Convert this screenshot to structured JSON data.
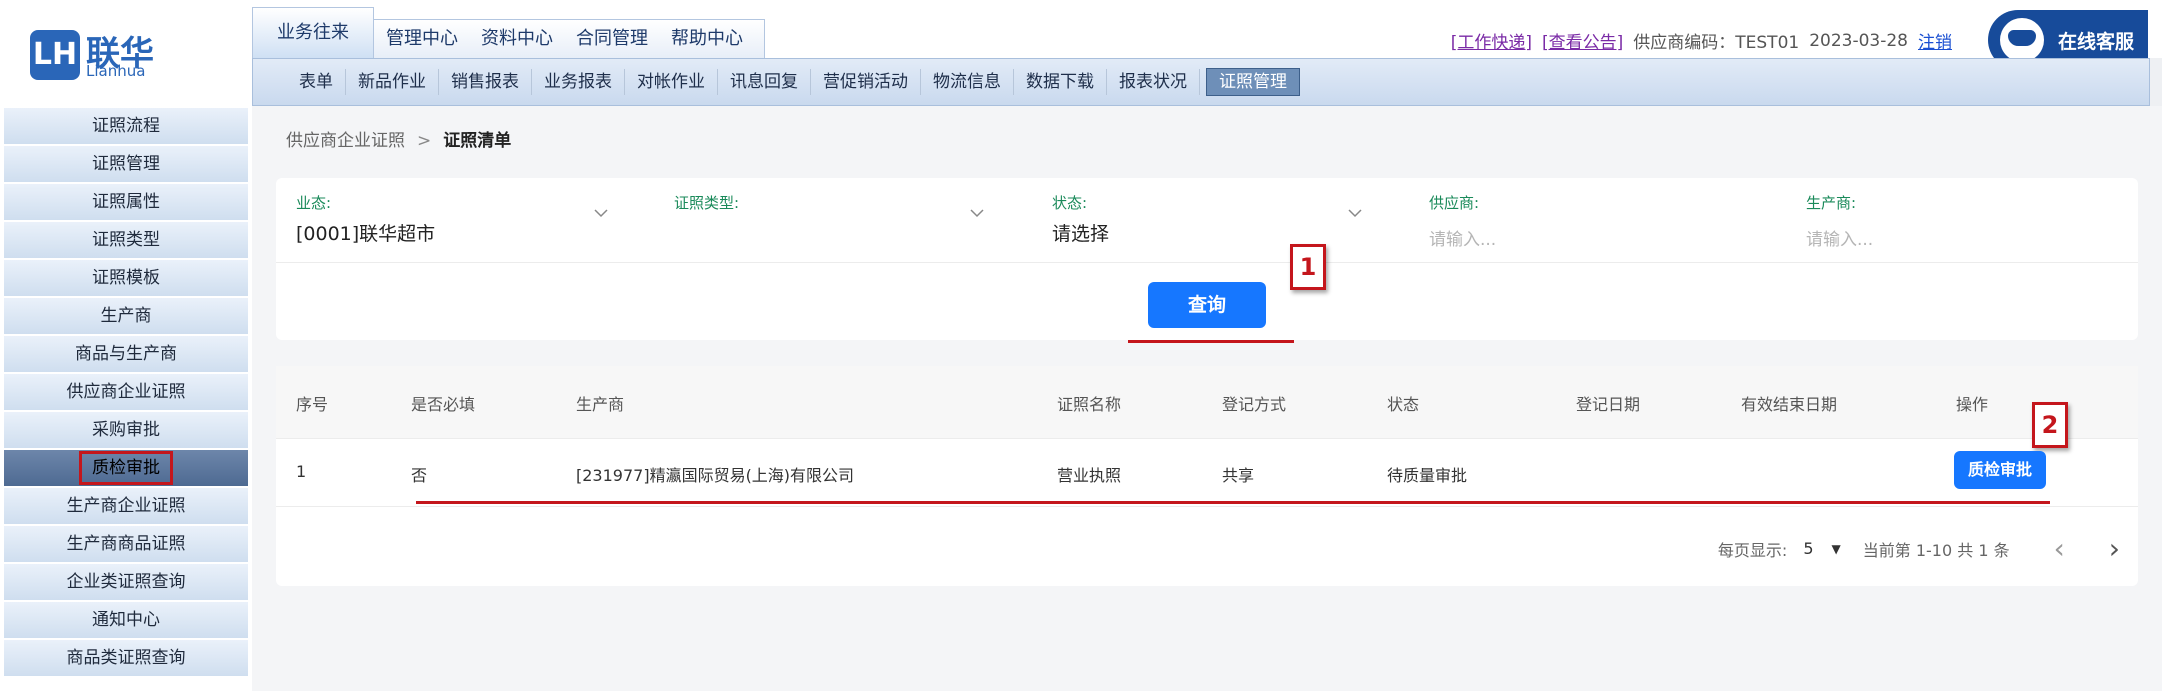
{
  "logo": {
    "mark": "LH",
    "name_cn": "联华",
    "name_en": "Lianhua"
  },
  "main_tabs": [
    "业务往来",
    "管理中心",
    "资料中心",
    "合同管理",
    "帮助中心"
  ],
  "top_links": {
    "work_quick": "[工作快递]",
    "notice": "[查看公告]",
    "supplier_code": "供应商编码：TEST01",
    "date": "2023-03-28",
    "logout": "注销"
  },
  "service": {
    "label": "在线客服"
  },
  "sub_nav": [
    "表单",
    "新品作业",
    "销售报表",
    "业务报表",
    "对帐作业",
    "讯息回复",
    "营促销活动",
    "物流信息",
    "数据下载",
    "报表状况",
    "证照管理"
  ],
  "sidebar": [
    "证照流程",
    "证照管理",
    "证照属性",
    "证照类型",
    "证照模板",
    "生产商",
    "商品与生产商",
    "供应商企业证照",
    "采购审批",
    "质检审批",
    "生产商企业证照",
    "生产商商品证照",
    "企业类证照查询",
    "通知中心",
    "商品类证照查询"
  ],
  "breadcrumb": {
    "parent": "供应商企业证照",
    "current": "证照清单"
  },
  "filters": {
    "business": {
      "label": "业态:",
      "value": "[0001]联华超市"
    },
    "cert_type": {
      "label": "证照类型:",
      "value": ""
    },
    "status": {
      "label": "状态:",
      "value": "请选择"
    },
    "supplier": {
      "label": "供应商:",
      "placeholder": "请输入..."
    },
    "producer": {
      "label": "生产商:",
      "placeholder": "请输入..."
    }
  },
  "query_button": "查询",
  "annotations": {
    "a1": "1",
    "a2": "2"
  },
  "table": {
    "headers": [
      "序号",
      "是否必填",
      "生产商",
      "证照名称",
      "登记方式",
      "状态",
      "登记日期",
      "有效结束日期",
      "操作"
    ],
    "rows": [
      {
        "index": "1",
        "required": "否",
        "producer": "[231977]精瀛国际贸易(上海)有限公司",
        "cert_name": "营业执照",
        "reg_method": "共享",
        "status": "待质量审批",
        "reg_date": "",
        "end_date": "",
        "action": "质检审批"
      }
    ]
  },
  "pager": {
    "per_page_label": "每页显示:",
    "per_page": "5",
    "summary": "当前第 1-10 共 1 条"
  },
  "colors": {
    "primary": "#1677ff",
    "annotation": "#c4161c",
    "nav_blue": "#174b9a"
  }
}
